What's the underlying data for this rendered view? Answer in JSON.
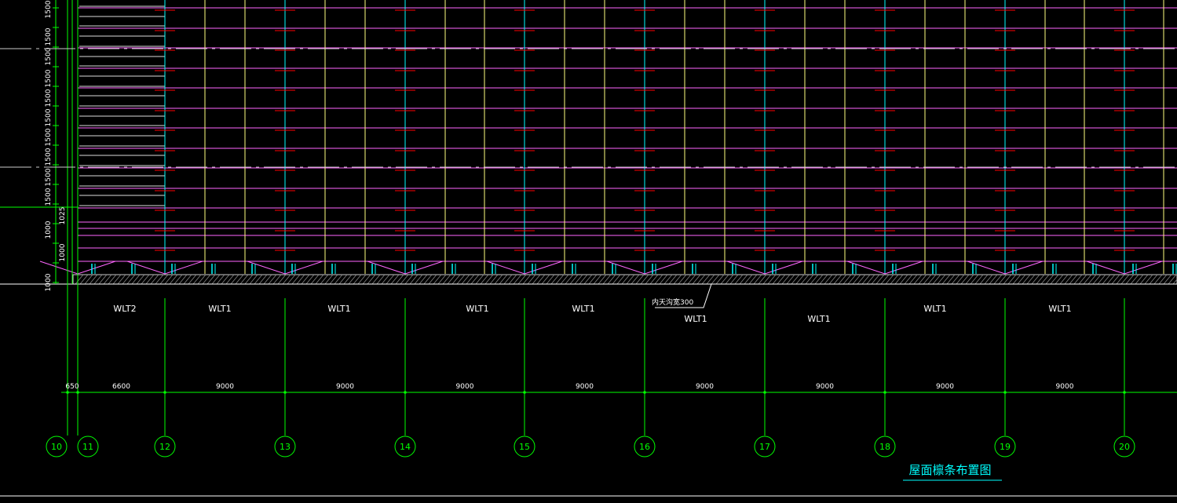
{
  "drawing": {
    "title": "屋面檩条布置图",
    "note": "内天沟宽300",
    "axes": [
      {
        "id": "10"
      },
      {
        "id": "11"
      },
      {
        "id": "12"
      },
      {
        "id": "13"
      },
      {
        "id": "14"
      },
      {
        "id": "15"
      },
      {
        "id": "16"
      },
      {
        "id": "17"
      },
      {
        "id": "18"
      },
      {
        "id": "19"
      },
      {
        "id": "20"
      }
    ],
    "spans": [
      "650",
      "6600",
      "9000",
      "9000",
      "9000",
      "9000",
      "9000",
      "9000",
      "9000",
      "9000"
    ],
    "purlin_labels": [
      "WLT2",
      "WLT1",
      "WLT1",
      "WLT1",
      "WLT1",
      "WLT1",
      "WLT1",
      "WLT1",
      "WLT1"
    ],
    "left_dims": [
      "1500",
      "1500",
      "1500",
      "1500",
      "1500",
      "1500",
      "1500",
      "1500",
      "1500",
      "1500",
      "1025",
      "1000",
      "1000",
      "1000"
    ]
  },
  "colors": {
    "background": "#000000",
    "grid_axis": "#00ff00",
    "column": "#00ffff",
    "rafter": "#ffff80",
    "purlin": "#ff66ff",
    "tie": "#ff0000",
    "text": "#ffffff",
    "title": "#00ffff"
  }
}
